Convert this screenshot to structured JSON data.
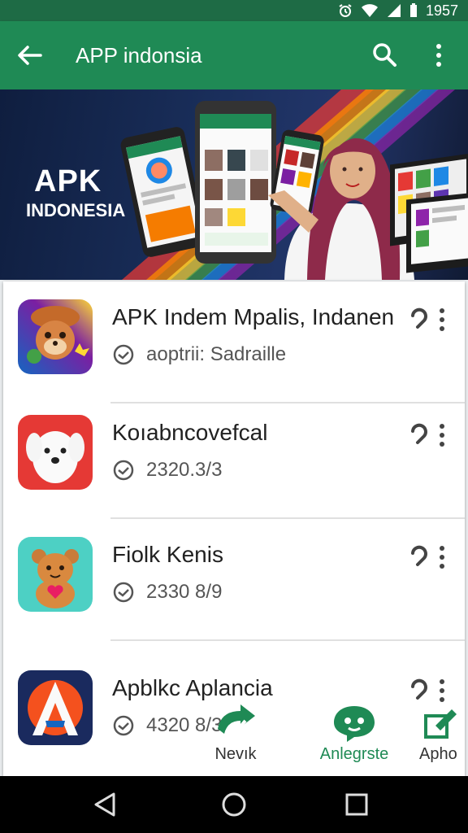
{
  "status_bar": {
    "time": "1957"
  },
  "app_bar": {
    "title": "APP indonsia"
  },
  "banner": {
    "title": "APK",
    "subtitle": "INDONESIA"
  },
  "apps": [
    {
      "name": "APK Indem Mpalis, Indanen",
      "meta": "aoptrii: Sadraille"
    },
    {
      "name": "Koıabncovefcal",
      "meta": "2320.3/3"
    },
    {
      "name": "Fiolk Kenis",
      "meta": "2330 8/9"
    },
    {
      "name": "Apblkc Aplancia",
      "meta": "4320 8/3"
    }
  ],
  "bottom_nav": [
    {
      "label": "Nevık"
    },
    {
      "label": "Anlegrste"
    },
    {
      "label": "Apho"
    }
  ],
  "colors": {
    "status_bar": "#1e6b45",
    "app_bar": "#1f8a55",
    "accent": "#1f8a55"
  }
}
